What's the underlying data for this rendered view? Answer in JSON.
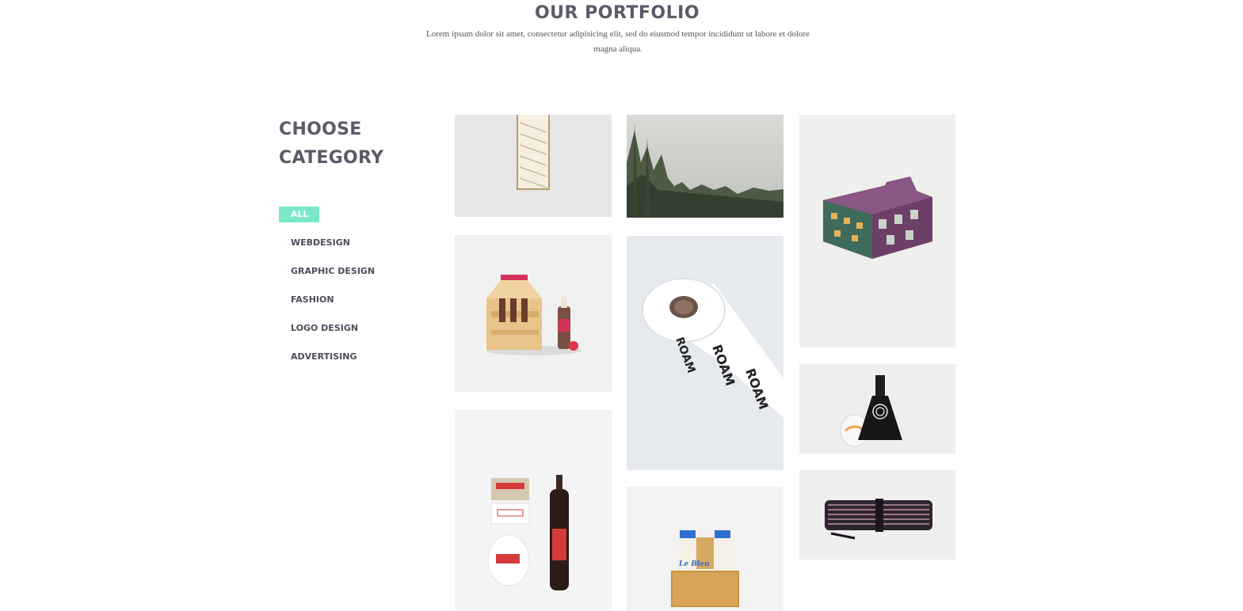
{
  "header": {
    "title_highlight": "OUR",
    "title_rest": " PORTFOLIO",
    "subtitle": "Lorem ipsum dolor sit amet, consectetur adipisicing elit, sed do eiusmod tempor incididunt ut labore et dolore magna aliqua."
  },
  "sidebar": {
    "heading_line1": "CHOOSE",
    "heading_line2": "CATEGORY",
    "categories": [
      {
        "label": "ALL",
        "active": true
      },
      {
        "label": "WEBDESIGN",
        "active": false
      },
      {
        "label": "GRAPHIC DESIGN",
        "active": false
      },
      {
        "label": "FASHION",
        "active": false
      },
      {
        "label": "LOGO DESIGN",
        "active": false
      },
      {
        "label": "ADVERTISING",
        "active": false
      }
    ]
  },
  "colors": {
    "accent": "#7ae8c8",
    "heading": "#5b5b68",
    "text": "#4d4d5c"
  },
  "portfolio": {
    "items": [
      {
        "subject": "staircase-photo"
      },
      {
        "subject": "foggy-forest-photo"
      },
      {
        "subject": "purple-gift-box-mockup"
      },
      {
        "subject": "wooden-bottle-carrier-mockup"
      },
      {
        "subject": "roam-tape-roll-mockup"
      },
      {
        "subject": "black-bottle-and-glass-mockup"
      },
      {
        "subject": "beer-bottle-branding-mockup"
      },
      {
        "subject": "milk-bottles-crate-mockup"
      },
      {
        "subject": "rolled-pencils-mockup"
      }
    ],
    "roam_text": "ROAM",
    "le_bleu_text": "Le Bleu"
  }
}
